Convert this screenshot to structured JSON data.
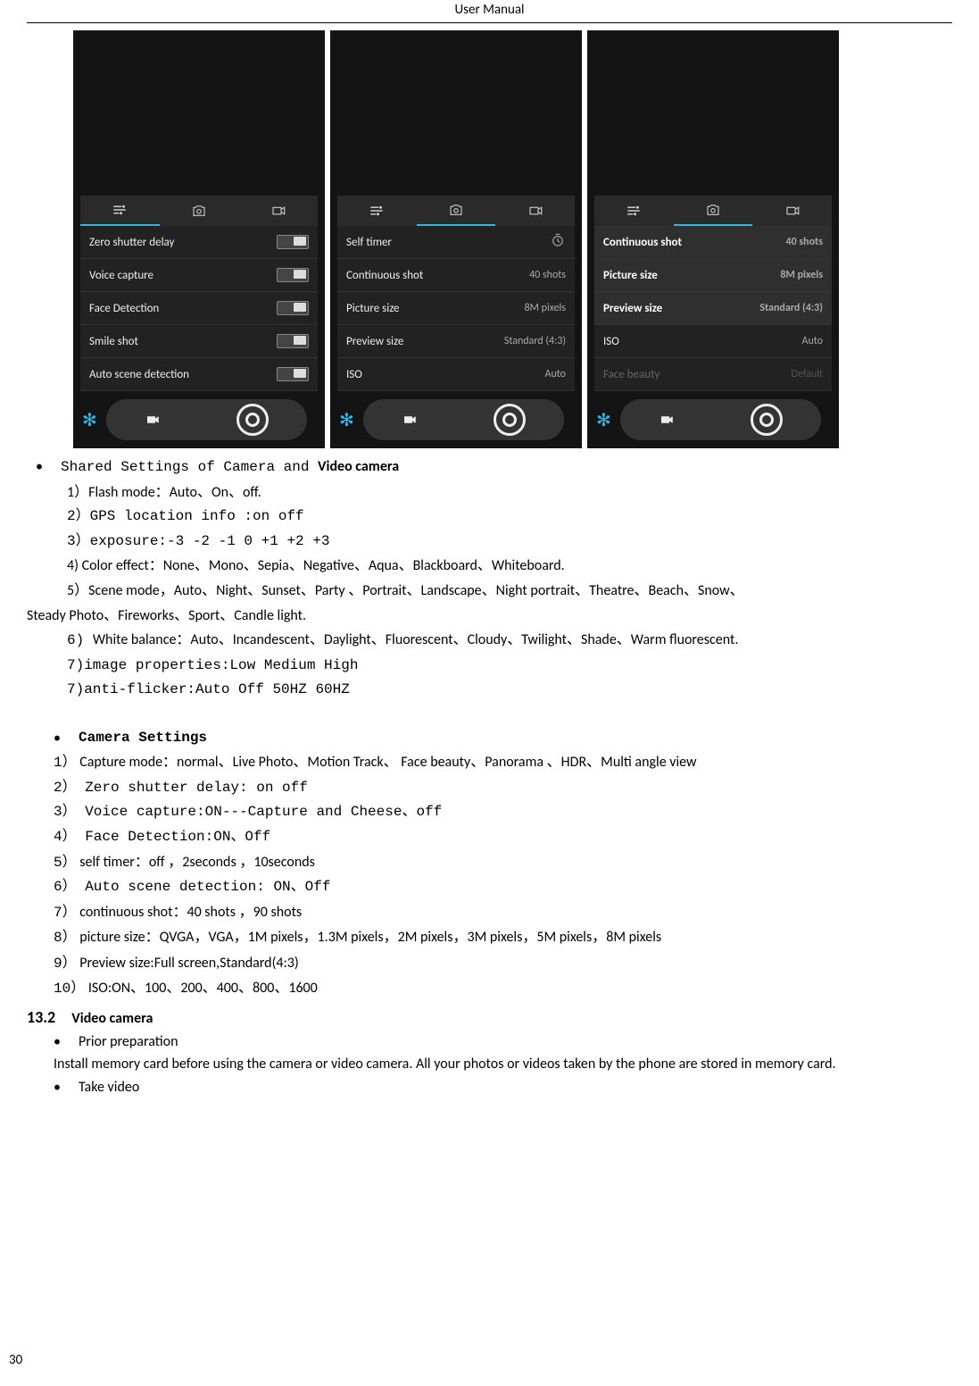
{
  "header": "User    Manual",
  "footer": "30",
  "screens": {
    "tabs": {
      "sliders": "≡",
      "camera": "camera",
      "video": "video"
    },
    "s1": {
      "activeTab": 0,
      "rows": [
        {
          "label": "Zero shutter delay",
          "type": "toggle"
        },
        {
          "label": "Voice capture",
          "type": "toggle"
        },
        {
          "label": "Face Detection",
          "type": "toggle"
        },
        {
          "label": "Smile shot",
          "type": "toggle"
        },
        {
          "label": "Auto scene detection",
          "type": "toggle"
        }
      ]
    },
    "s2": {
      "activeTab": 1,
      "rows": [
        {
          "label": "Self timer",
          "val": "icon-timer"
        },
        {
          "label": "Continuous shot",
          "val": "40 shots"
        },
        {
          "label": "Picture size",
          "val": "8M pixels"
        },
        {
          "label": "Preview size",
          "val": "Standard (4:3)"
        },
        {
          "label": "ISO",
          "val": "Auto"
        }
      ]
    },
    "s3": {
      "activeTab": 1,
      "rows": [
        {
          "label": "Continuous shot",
          "val": "40 shots",
          "sel": true
        },
        {
          "label": "Picture size",
          "val": "8M pixels",
          "sel": true
        },
        {
          "label": "Preview size",
          "val": "Standard (4:3)",
          "sel": true
        },
        {
          "label": "ISO",
          "val": "Auto"
        },
        {
          "label": "Face beauty",
          "val": "Default",
          "dim": true
        }
      ]
    }
  },
  "shared": {
    "title_prefix": "Shared Settings of Camera and ",
    "title_bold": "Video camera",
    "items": {
      "i1": "1）Flash mode：Auto、On、off.",
      "i2": "2）GPS location info :on   off",
      "i3": "3）exposure:-3  -2  -1  0  +1  +2  +3",
      "i4": "4)   Color effect：None、Mono、Sepia、Negative、Aqua、Blackboard、Whiteboard.",
      "i5": "5）Scene mode，Auto、Night、Sunset、Party 、Portrait、Landscape、Night portrait、Theatre、Beach、Snow、",
      "i5b": "Steady Photo、Fireworks、Sport、Candle light.",
      "i6": "6) White balance：Auto、Incandescent、Daylight、Fluorescent、Cloudy、Twilight、Shade、Warm fluorescent.",
      "i7": "7)image properties:Low  Medium  High",
      "i8": "7)anti-flicker:Auto  Off  50HZ  60HZ"
    }
  },
  "camera": {
    "title": "Camera Settings",
    "items": {
      "c1_pre": "1）",
      "c1": " Capture mode：normal、Live Photo、Motion Track、  Face beauty、Panorama   、HDR、Multi angle view",
      "c2": "2） Zero shutter delay: on  off",
      "c3": "3） Voice capture:ON---Capture and Cheese、off",
      "c4": "4） Face Detection:ON、Off",
      "c5_pre": "5）",
      "c5": " self timer：off ，2seconds ，10seconds",
      "c6": "6） Auto scene detection: ON、Off",
      "c7_pre": "7）",
      "c7": " continuous shot：40 shots ，90 shots",
      "c8_pre": "8）",
      "c8": " picture size：QVGA，VGA，1M pixels，1.3M pixels，2M pixels，3M pixels，5M pixels，8M pixels",
      "c9_pre": "9）",
      "c9": " Preview size:Full screen,Standard(4:3)",
      "c10_pre": "10）",
      "c10": "   ISO:ON、100、200、400、800、1600"
    }
  },
  "sec132": {
    "num": "13.2",
    "title": "Video camera",
    "b1": "Prior preparation",
    "p1": "Install memory card before using the camera or video camera. All your photos or videos taken by the phone are stored in memory card.",
    "b2": "Take video"
  }
}
